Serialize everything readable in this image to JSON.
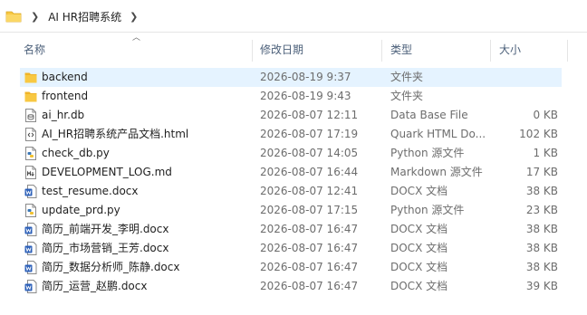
{
  "address": {
    "crumbs": [
      "AI HR招聘系统"
    ]
  },
  "columns": {
    "name": "名称",
    "date": "修改日期",
    "type": "类型",
    "size": "大小"
  },
  "files": [
    {
      "name": "backend",
      "date": "2026-08-19 9:37",
      "type": "文件夹",
      "size": "",
      "icon": "folder-icon",
      "selected": true
    },
    {
      "name": "frontend",
      "date": "2026-08-19 9:43",
      "type": "文件夹",
      "size": "",
      "icon": "folder-icon"
    },
    {
      "name": "ai_hr.db",
      "date": "2026-08-07 12:11",
      "type": "Data Base File",
      "size": "0 KB",
      "icon": "database-file-icon"
    },
    {
      "name": "AI_HR招聘系统产品文档.html",
      "date": "2026-08-07 17:19",
      "type": "Quark HTML Do...",
      "size": "102 KB",
      "icon": "html-file-icon"
    },
    {
      "name": "check_db.py",
      "date": "2026-08-07 14:05",
      "type": "Python 源文件",
      "size": "1 KB",
      "icon": "python-file-icon"
    },
    {
      "name": "DEVELOPMENT_LOG.md",
      "date": "2026-08-07 16:44",
      "type": "Markdown 源文件",
      "size": "17 KB",
      "icon": "markdown-file-icon"
    },
    {
      "name": "test_resume.docx",
      "date": "2026-08-07 12:41",
      "type": "DOCX 文档",
      "size": "38 KB",
      "icon": "word-file-icon"
    },
    {
      "name": "update_prd.py",
      "date": "2026-08-07 17:15",
      "type": "Python 源文件",
      "size": "23 KB",
      "icon": "python-file-icon"
    },
    {
      "name": "简历_前端开发_李明.docx",
      "date": "2026-08-07 16:47",
      "type": "DOCX 文档",
      "size": "38 KB",
      "icon": "word-file-icon"
    },
    {
      "name": "简历_市场营销_王芳.docx",
      "date": "2026-08-07 16:47",
      "type": "DOCX 文档",
      "size": "38 KB",
      "icon": "word-file-icon"
    },
    {
      "name": "简历_数据分析师_陈静.docx",
      "date": "2026-08-07 16:47",
      "type": "DOCX 文档",
      "size": "38 KB",
      "icon": "word-file-icon"
    },
    {
      "name": "简历_运营_赵鹏.docx",
      "date": "2026-08-07 16:47",
      "type": "DOCX 文档",
      "size": "39 KB",
      "icon": "word-file-icon"
    }
  ],
  "colors": {
    "folder": "#f8c842",
    "word": "#2b5fb8",
    "selection": "#e5f3ff"
  }
}
